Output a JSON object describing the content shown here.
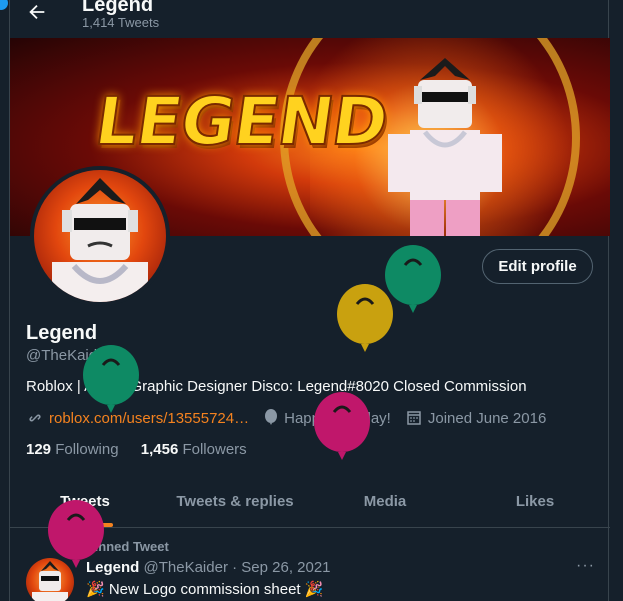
{
  "header": {
    "title": "Legend",
    "tweet_count": "1,414 Tweets"
  },
  "banner": {
    "word": "LEGEND"
  },
  "profile": {
    "edit_label": "Edit profile",
    "name": "Legend",
    "handle": "@TheKaider",
    "bio": "Roblox | Artist | Graphic Designer Disco: Legend#8020 Closed Commission",
    "link": "roblox.com/users/13555724…",
    "birthday": "Happy Birthday!",
    "joined": "Joined June 2016",
    "following_count": "129",
    "following_label": "Following",
    "followers_count": "1,456",
    "followers_label": "Followers"
  },
  "tabs": [
    {
      "label": "Tweets",
      "active": true
    },
    {
      "label": "Tweets & replies",
      "active": false
    },
    {
      "label": "Media",
      "active": false
    },
    {
      "label": "Likes",
      "active": false
    }
  ],
  "pinned_tweet": {
    "pinned_label": "Pinned Tweet",
    "author": "Legend",
    "handle_date": "@TheKaider · Sep 26, 2021",
    "text": "🎉 New Logo commission sheet 🎉",
    "more": "···"
  },
  "colors": {
    "background": "#15202b",
    "accent": "#f4821f",
    "muted": "#8b98a5",
    "balloon_green": "#0e8a64",
    "balloon_yellow": "#c9a10f",
    "balloon_magenta": "#c0176b"
  },
  "icons": [
    "back-arrow-icon",
    "link-icon",
    "balloon-icon",
    "calendar-icon",
    "pin-icon",
    "more-icon"
  ]
}
